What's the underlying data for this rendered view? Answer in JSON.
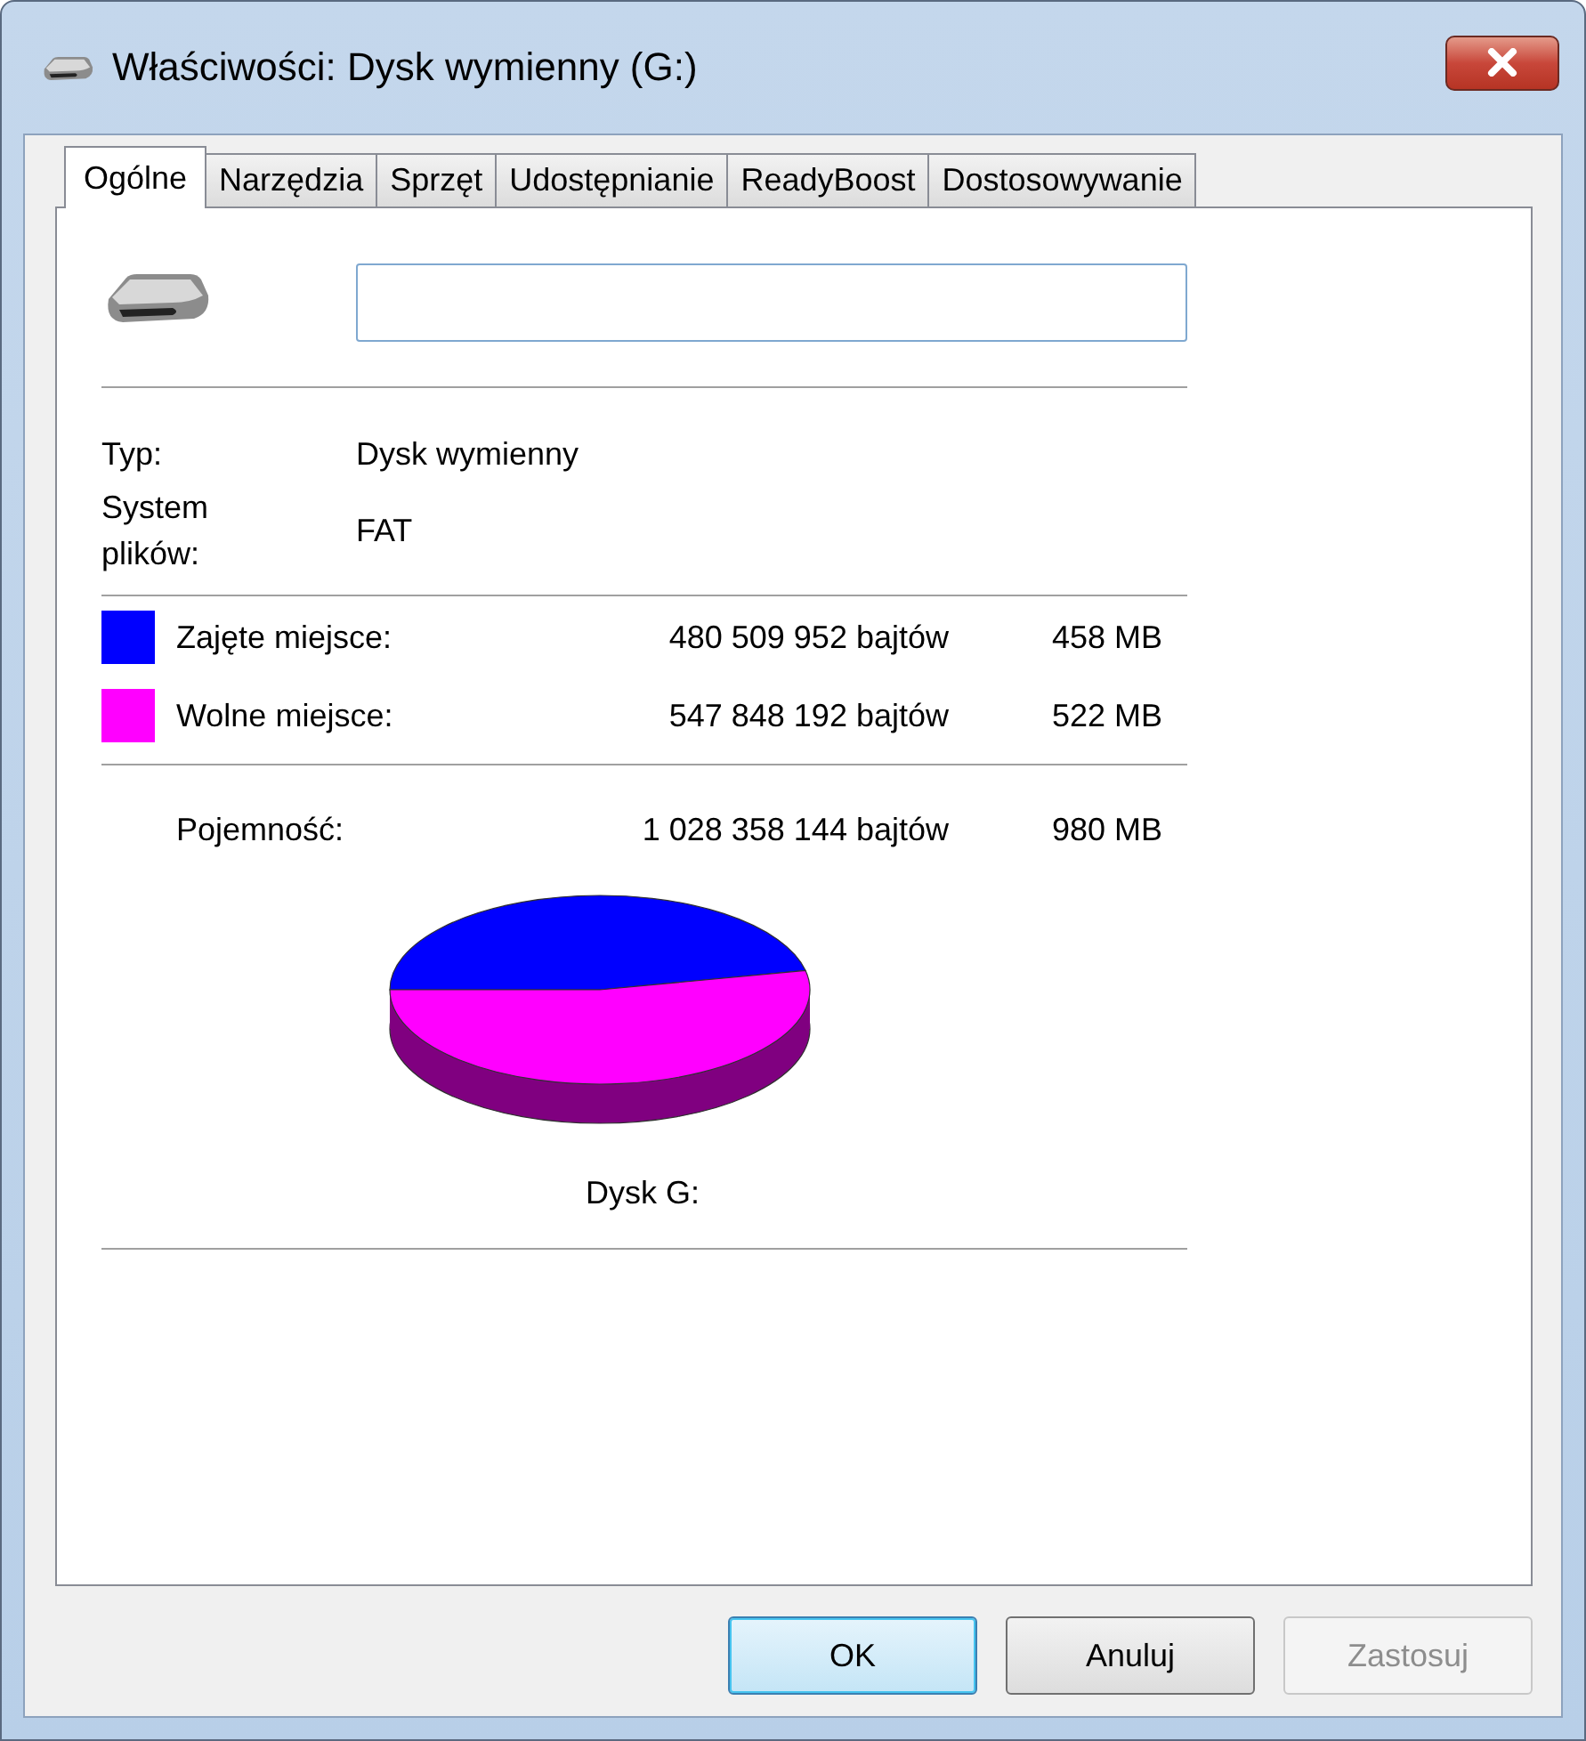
{
  "window": {
    "title": "Właściwości: Dysk wymienny (G:)"
  },
  "tabs": [
    {
      "label": "Ogólne",
      "selected": true
    },
    {
      "label": "Narzędzia",
      "selected": false
    },
    {
      "label": "Sprzęt",
      "selected": false
    },
    {
      "label": "Udostępnianie",
      "selected": false
    },
    {
      "label": "ReadyBoost",
      "selected": false
    },
    {
      "label": "Dostosowywanie",
      "selected": false
    }
  ],
  "properties": [
    {
      "label": "Typ:",
      "value": "Dysk wymienny"
    },
    {
      "label": "System plików:",
      "value": "FAT"
    }
  ],
  "usage": [
    {
      "label": "Zajęte miejsce:",
      "bytes": "480 509 952 bajtów",
      "size": "458 MB",
      "color": "#0000ff"
    },
    {
      "label": "Wolne miejsce:",
      "bytes": "547 848 192 bajtów",
      "size": "522 MB",
      "color": "#ff00ff"
    }
  ],
  "capacity": {
    "label": "Pojemność:",
    "bytes": "1 028 358 144 bajtów",
    "size": "980 MB"
  },
  "drive_label": "Dysk G:",
  "buttons": [
    {
      "label": "OK",
      "default": true,
      "disabled": false
    },
    {
      "label": "Anuluj",
      "default": false,
      "disabled": false
    },
    {
      "label": "Zastosuj",
      "default": false,
      "disabled": true
    }
  ]
}
